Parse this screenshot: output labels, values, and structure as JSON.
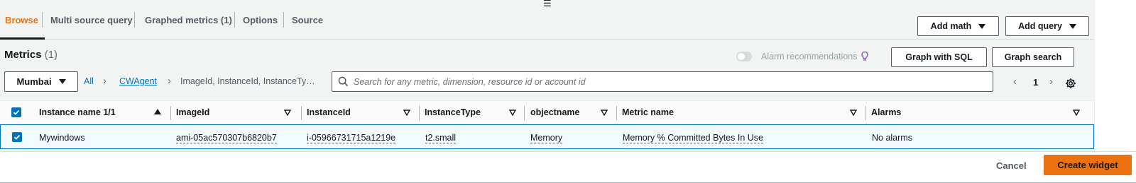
{
  "tabs": [
    {
      "label": "Browse"
    },
    {
      "label": "Multi source query"
    },
    {
      "label": "Graphed metrics (1)"
    },
    {
      "label": "Options"
    },
    {
      "label": "Source"
    }
  ],
  "toolbar": {
    "add_math": "Add math",
    "add_query": "Add query"
  },
  "metrics": {
    "title": "Metrics",
    "count": "(1)"
  },
  "alarm_recommendations": {
    "label": "Alarm recommendations",
    "enabled": false
  },
  "actions": {
    "graph_sql": "Graph with SQL",
    "graph_search": "Graph search"
  },
  "region": {
    "selected": "Mumbai"
  },
  "breadcrumb": {
    "all": "All",
    "namespace": "CWAgent",
    "dimensions": "ImageId, InstanceId, InstanceTy…"
  },
  "search": {
    "placeholder": "Search for any metric, dimension, resource id or account id",
    "value": ""
  },
  "pagination": {
    "page": "1"
  },
  "table": {
    "columns": [
      "Instance name 1/1",
      "ImageId",
      "InstanceId",
      "InstanceType",
      "objectname",
      "Metric name",
      "Alarms"
    ],
    "rows": [
      {
        "instance_name": "Mywindows",
        "image_id": "ami-05ac570307b6820b7",
        "instance_id": "i-05966731715a1219e",
        "instance_type": "t2.small",
        "objectname": "Memory",
        "metric_name": "Memory % Committed Bytes In Use",
        "alarms": "No alarms",
        "selected": true
      }
    ]
  },
  "footer": {
    "cancel": "Cancel",
    "create_widget": "Create widget"
  },
  "colors": {
    "accent": "#ec7211",
    "link": "#0073bb",
    "selected_row": "#f1faff"
  }
}
